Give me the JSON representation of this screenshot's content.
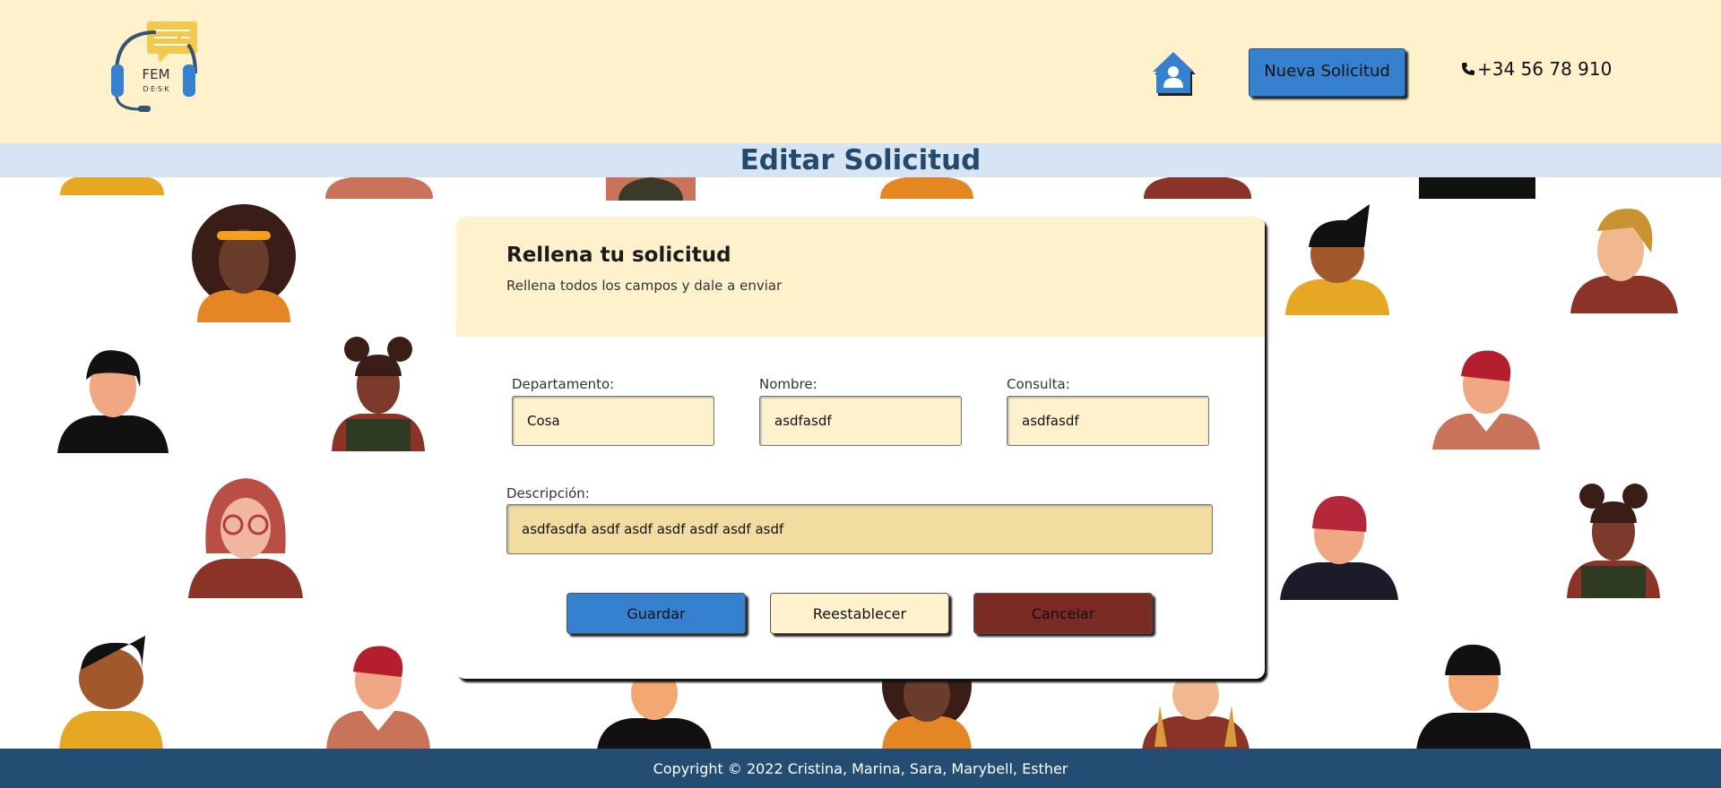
{
  "header": {
    "logo_text": "FEM",
    "logo_subtext": "D·E·S·K",
    "home_icon": "home-user-icon",
    "new_request_label": "Nueva Solicitud",
    "phone_icon": "phone-icon",
    "phone": "+34 56 78 910"
  },
  "page_title": "Editar Solicitud",
  "form": {
    "title": "Rellena tu solicitud",
    "subtitle": "Rellena todos los campos y dale a enviar",
    "departamento_label": "Departamento:",
    "departamento_value": "Cosa",
    "nombre_label": "Nombre:",
    "nombre_value": "asdfasdf",
    "consulta_label": "Consulta:",
    "consulta_value": "asdfasdf",
    "descripcion_label": "Descripción:",
    "descripcion_value": "asdfasdfa asdf asdf asdf asdf asdf asdf",
    "save_label": "Guardar",
    "reset_label": "Reestablecer",
    "cancel_label": "Cancelar"
  },
  "footer": {
    "copyright": "Copyright © 2022 Cristina, Marina, Sara, Marybell, Esther"
  },
  "colors": {
    "header_bg": "#fef1cb",
    "title_bar_bg": "#d6e4f3",
    "title_color": "#23496d",
    "primary_blue": "#3580cf",
    "cancel_red": "#7b2b24",
    "footer_bg": "#244d74"
  }
}
